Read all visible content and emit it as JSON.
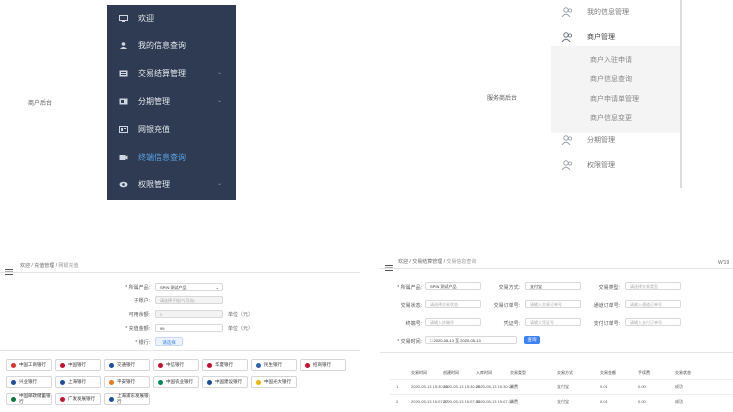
{
  "top_left": {
    "caption": "商户后台"
  },
  "dark_sidebar": {
    "items": [
      {
        "label": "欢迎",
        "icon": "monitor-icon",
        "chevron": false
      },
      {
        "label": "我的信息查询",
        "icon": "user-icon",
        "chevron": false
      },
      {
        "label": "交易结算管理",
        "icon": "ledger-icon",
        "chevron": true
      },
      {
        "label": "分期管理",
        "icon": "installment-icon",
        "chevron": true
      },
      {
        "label": "网银充值",
        "icon": "card-icon",
        "chevron": false
      },
      {
        "label": "终端信息查询",
        "icon": "terminal-icon",
        "chevron": false,
        "active": true
      },
      {
        "label": "权限管理",
        "icon": "eye-icon",
        "chevron": true
      }
    ],
    "colors": {
      "bg": "#2e3b52",
      "text": "#e6e9ef",
      "active": "#5aa3e6"
    }
  },
  "top_right": {
    "caption": "服务商后台",
    "items": [
      {
        "label": "我的信息管理",
        "icon": "users-icon"
      },
      {
        "label": "商户管理",
        "icon": "users-icon"
      },
      {
        "label": "分期管理",
        "icon": "users-icon"
      },
      {
        "label": "权限管理",
        "icon": "users-icon"
      }
    ],
    "sub_items": [
      "商户入驻申请",
      "商户信息查询",
      "商户申请单管理",
      "商户信息变更"
    ]
  },
  "recharge_panel": {
    "breadcrumb": [
      "欢迎",
      "充值管理",
      "网银充值"
    ],
    "fields": [
      {
        "label": "* 所属产品:",
        "value": "SPIN 测试产品",
        "type": "select"
      },
      {
        "label": "子账户:",
        "value": "请选择子账户(可选)",
        "type": "input-gray"
      },
      {
        "label": "可用余额:",
        "value": "0",
        "unit": "单位（元）",
        "type": "input-gray"
      },
      {
        "label": "* 充值金额:",
        "value": "99",
        "unit": "单位（元）",
        "type": "input"
      },
      {
        "label": "* 银行:",
        "value": "请选择",
        "type": "button"
      }
    ],
    "banks": [
      [
        "中国工商银行",
        "中国银行",
        "交通银行",
        "中信银行",
        "华夏银行",
        "民生银行",
        "招商银行"
      ],
      [
        "兴业银行",
        "上海银行",
        "平安银行",
        "中国农业银行",
        "中国建设银行",
        "中国光大银行"
      ],
      [
        "中国邮政储蓄银行",
        "广发发展银行",
        "上海浦东发展银行"
      ]
    ],
    "bank_colors": [
      "#d9342b",
      "#c8102e",
      "#1f4e9c",
      "#c8102e",
      "#c8102e",
      "#2a66b1",
      "#c8102e",
      "#1f4e9c",
      "#1f4e9c",
      "#e87722",
      "#008c5a",
      "#1a4d94",
      "#f0b400",
      "#007a3d",
      "#c8102e",
      "#1f4e9c"
    ]
  },
  "trade_panel": {
    "breadcrumb": [
      "欢迎",
      "交易结算管理",
      "交易信息查询"
    ],
    "right_cut": "W'19",
    "filters": [
      {
        "label": "* 所属产品:",
        "value": "SPIN 测试产品"
      },
      {
        "label": "交易方式:",
        "value": "支付宝"
      },
      {
        "label": "交易类型:",
        "value": "请选择交易类型"
      },
      {
        "label": "交易状态:",
        "value": "请选择交易状态"
      },
      {
        "label": "交易订单号:",
        "value": "请输入交易订单号"
      },
      {
        "label": "通道订单号:",
        "value": "请输入通道订单号"
      },
      {
        "label": "终端号:",
        "value": "请输入终端号"
      },
      {
        "label": "凭证号:",
        "value": "请输入凭证号"
      },
      {
        "label": "支付订单号:",
        "value": "请输入支付订单号"
      }
    ],
    "date_label": "* 交易时间:",
    "date_from": "2020-05-13",
    "date_sep": "至",
    "date_to": "2020-05-13",
    "search_label": "查询",
    "columns": [
      "",
      "交易时间",
      "创建时间",
      "入库时间",
      "交易类型",
      "交易方式",
      "交易金额",
      "手续费",
      "交易状态"
    ],
    "rows": [
      [
        "1",
        "2020-05-13 15:30:18",
        "2020-05-13 15:30:25",
        "2020-05-13 15:30:26",
        "消费",
        "支付宝",
        "0.01",
        "0.00",
        "成功"
      ],
      [
        "2",
        "2020-05-13 15:07:27",
        "2020-05-13 15:07:33",
        "2020-05-13 15:07:33",
        "消费",
        "支付宝",
        "0.01",
        "0.00",
        "成功"
      ]
    ]
  }
}
